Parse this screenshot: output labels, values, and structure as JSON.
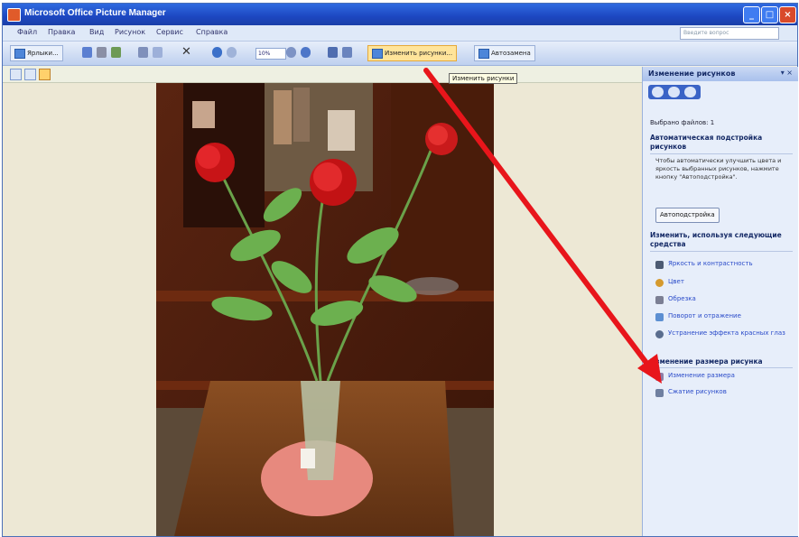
{
  "window": {
    "title": "Microsoft Office Picture Manager",
    "buttons": {
      "minimize": "_",
      "maximize": "□",
      "close": "×"
    }
  },
  "menubar": {
    "items": [
      "Файл",
      "Правка",
      "Вид",
      "Рисунок",
      "Сервис",
      "Справка"
    ],
    "help_placeholder": "Введите вопрос"
  },
  "toolbar": {
    "import_label": "Ярлыки...",
    "zoom_value": "10%",
    "edit_button_label": "Изменить рисунки...",
    "autocorrect_button_label": "Автозамена"
  },
  "tooltip": {
    "text": "Изменить рисунки"
  },
  "task_pane": {
    "title": "Изменение рисунков",
    "close": "▾ ×",
    "selected_files": "Выбрано файлов: 1",
    "autocorrect_section": "Автоматическая подстройка рисунков",
    "autocorrect_text": "Чтобы автоматически улучшить цвета и яркость выбранных рисунков, нажмите кнопку \"Автоподстройка\".",
    "autocorrect_button": "Автоподстройка",
    "tools_section": "Изменить, используя следующие средства",
    "tools": [
      "Яркость и контрастность",
      "Цвет",
      "Обрезка",
      "Поворот и отражение",
      "Устранение эффекта красных глаз"
    ],
    "size_section": "Изменение размера рисунка",
    "size_tools": [
      "Изменение размера",
      "Сжатие рисунков"
    ]
  },
  "colors": {
    "titlebar": "#1d47c1",
    "pane_bg": "#e7eefa",
    "link": "#2a4bc9",
    "arrow": "#e8151b",
    "highlight": "#ffe49a"
  },
  "icons": [
    "app-icon",
    "paste-icon",
    "save-icon",
    "print-icon",
    "delete-icon",
    "undo-icon",
    "redo-icon",
    "zoom-out-icon",
    "zoom-in-icon",
    "edit-pictures-icon",
    "autocorrect-icon",
    "thumbnails-view-icon",
    "filmstrip-view-icon",
    "single-picture-view-icon"
  ]
}
